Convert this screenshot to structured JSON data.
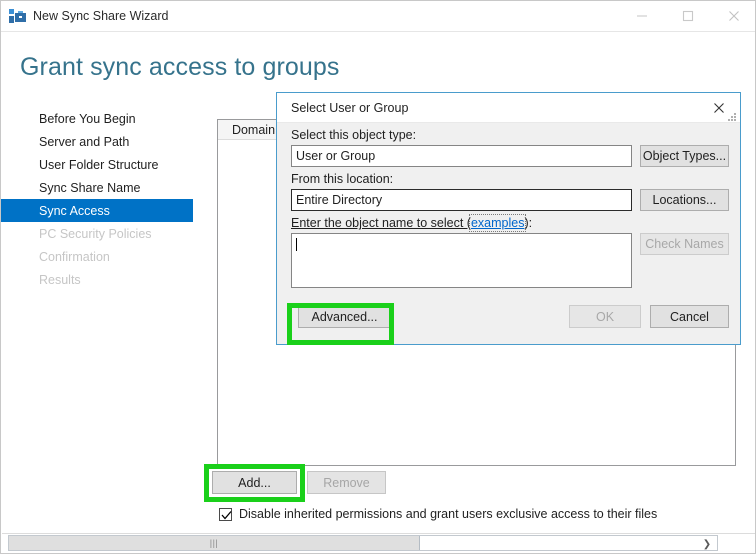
{
  "window": {
    "title": "New Sync Share Wizard",
    "icon": "sync-share-icon",
    "controls": {
      "minimize": "minimize-icon",
      "maximize": "maximize-icon",
      "close": "close-icon"
    }
  },
  "page": {
    "title": "Grant sync access to groups"
  },
  "sidebar": {
    "items": [
      {
        "label": "Before You Begin",
        "state": "enabled"
      },
      {
        "label": "Server and Path",
        "state": "enabled"
      },
      {
        "label": "User Folder Structure",
        "state": "enabled"
      },
      {
        "label": "Sync Share Name",
        "state": "enabled"
      },
      {
        "label": "Sync Access",
        "state": "active"
      },
      {
        "label": "PC Security Policies",
        "state": "disabled"
      },
      {
        "label": "Confirmation",
        "state": "disabled"
      },
      {
        "label": "Results",
        "state": "disabled"
      }
    ]
  },
  "main": {
    "listview": {
      "columns": [
        "Domain"
      ],
      "rows": []
    },
    "buttons": {
      "add": "Add...",
      "remove": "Remove"
    },
    "checkbox": {
      "label": "Disable inherited permissions and grant users exclusive access to their files",
      "checked": true
    }
  },
  "scrollbar": {
    "grip": "|||",
    "right_arrow": "❯"
  },
  "dialog": {
    "title": "Select User or Group",
    "close_icon": "close-icon",
    "object_type": {
      "label": "Select this object type:",
      "value": "User or Group",
      "button": "Object Types..."
    },
    "location": {
      "label": "From this location:",
      "value": "Entire Directory",
      "button": "Locations..."
    },
    "object_name": {
      "label_prefix": "Enter the object name to select (",
      "label_link": "examples",
      "label_suffix": "):",
      "value": "",
      "button": "Check Names"
    },
    "buttons": {
      "advanced": "Advanced...",
      "ok": "OK",
      "cancel": "Cancel"
    }
  },
  "highlights": {
    "color": "#1ad01a",
    "targets": [
      "add-button",
      "advanced-button"
    ]
  }
}
